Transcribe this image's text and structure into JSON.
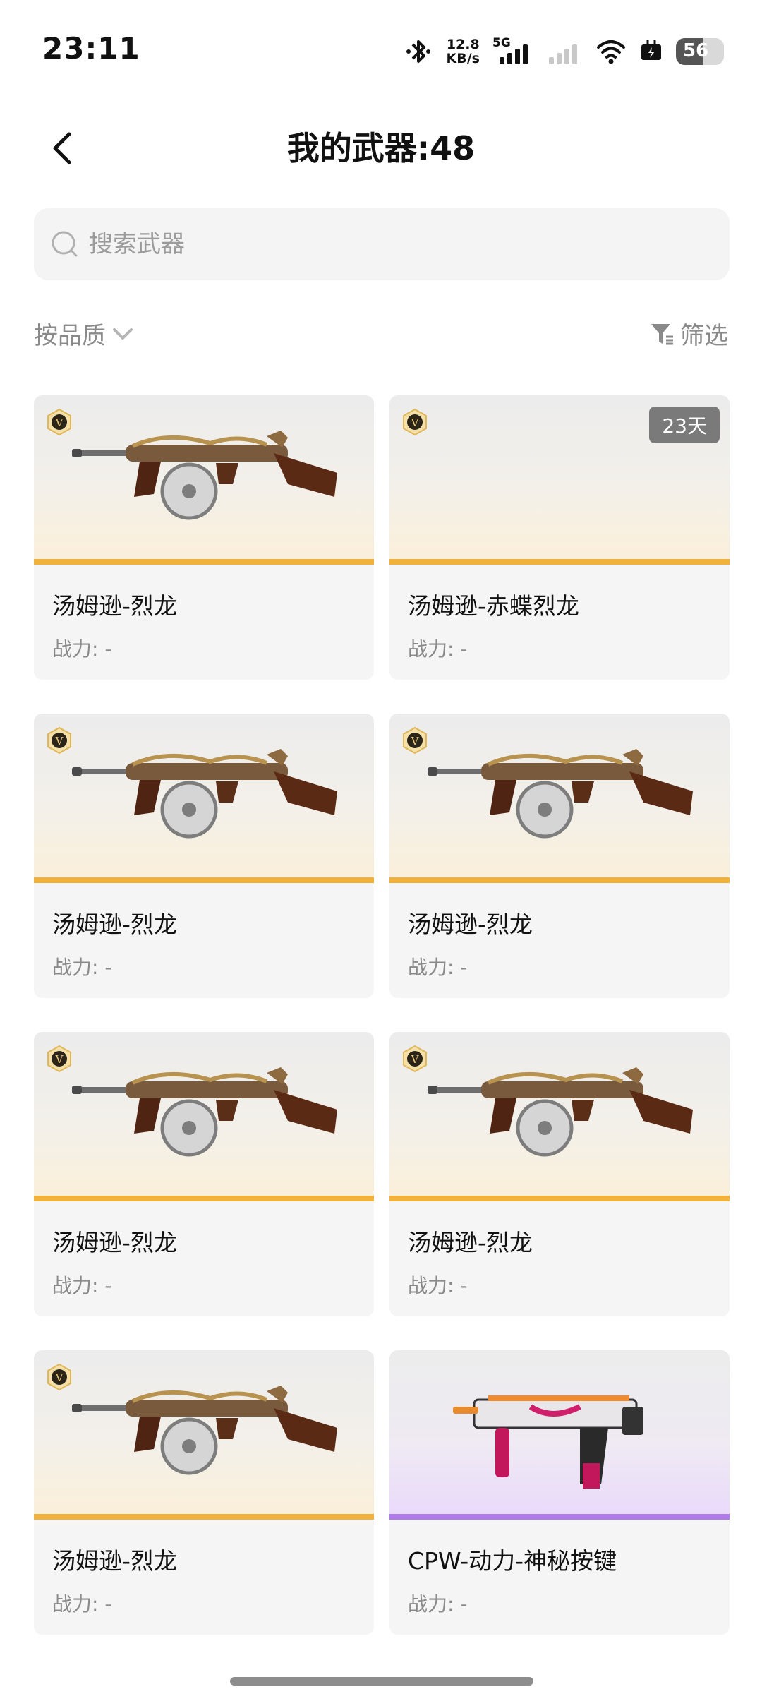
{
  "status_bar": {
    "time": "23:11",
    "net_speed_value": "12.8",
    "net_speed_unit": "KB/s",
    "network": "5G",
    "battery": "56"
  },
  "header": {
    "title": "我的武器:48"
  },
  "search": {
    "placeholder": "搜索武器"
  },
  "sort": {
    "label": "按品质"
  },
  "filter": {
    "label": "筛选"
  },
  "cards": [
    {
      "name": "汤姆逊-烈龙",
      "power": "战力: -",
      "days": "",
      "style": "gold",
      "image": "tommy-gun-dragon",
      "badge": "V"
    },
    {
      "name": "汤姆逊-赤蝶烈龙",
      "power": "战力: -",
      "days": "23天",
      "style": "gold",
      "image": "",
      "badge": "V"
    },
    {
      "name": "汤姆逊-烈龙",
      "power": "战力: -",
      "days": "",
      "style": "gold",
      "image": "tommy-gun-dragon",
      "badge": "V"
    },
    {
      "name": "汤姆逊-烈龙",
      "power": "战力: -",
      "days": "",
      "style": "gold",
      "image": "tommy-gun-dragon",
      "badge": "V"
    },
    {
      "name": "汤姆逊-烈龙",
      "power": "战力: -",
      "days": "",
      "style": "gold",
      "image": "tommy-gun-dragon",
      "badge": "V"
    },
    {
      "name": "汤姆逊-烈龙",
      "power": "战力: -",
      "days": "",
      "style": "gold",
      "image": "tommy-gun-dragon",
      "badge": "V"
    },
    {
      "name": "汤姆逊-烈龙",
      "power": "战力: -",
      "days": "",
      "style": "gold",
      "image": "tommy-gun-dragon",
      "badge": "V"
    },
    {
      "name": "CPW-动力-神秘按键",
      "power": "战力: -",
      "days": "",
      "style": "purple",
      "image": "cpw-smg",
      "badge": ""
    }
  ],
  "colors": {
    "gold_accent": "#f0b23b",
    "purple_accent": "#b07de8",
    "badge_bg": "#7a7a7a"
  }
}
